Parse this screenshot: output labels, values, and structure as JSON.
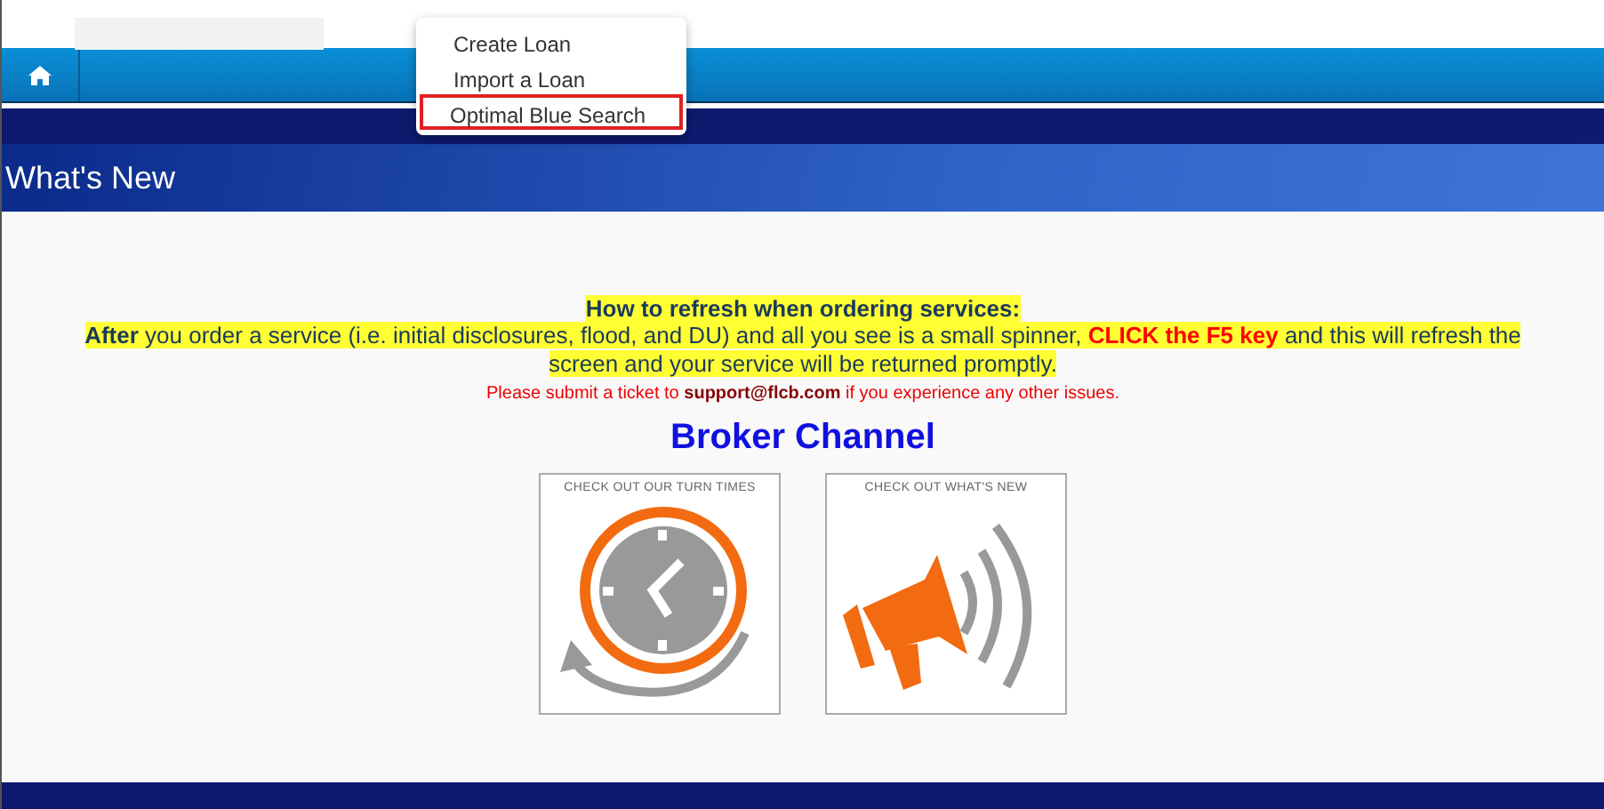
{
  "menu": {
    "items": [
      {
        "label": "Create Loan",
        "selected": false
      },
      {
        "label": "Import a Loan",
        "selected": false
      },
      {
        "label": "Optimal Blue Search",
        "selected": true
      }
    ]
  },
  "header": {
    "title": "What's New"
  },
  "notice": {
    "heading": "How to refresh when ordering services:",
    "segments": [
      {
        "kind": "bold",
        "text": "After"
      },
      {
        "kind": "plain",
        "text": " you order a service (i.e. initial disclosures, flood, and DU) and all you see is a small spinner, "
      },
      {
        "kind": "alert",
        "text": "CLICK the F5 key"
      },
      {
        "kind": "plain",
        "text": " and this will refresh the screen and your service will be returned promptly."
      }
    ],
    "support": {
      "before": "Please submit a ticket to ",
      "link": "support@flcb.com",
      "after": " if you experience any other issues."
    }
  },
  "channel": {
    "title": "Broker Channel"
  },
  "tiles": [
    {
      "kind": "clock",
      "caption": "CHECK OUT OUR TURN TIMES"
    },
    {
      "kind": "megaphone",
      "caption": "CHECK OUT WHAT'S NEW"
    }
  ]
}
